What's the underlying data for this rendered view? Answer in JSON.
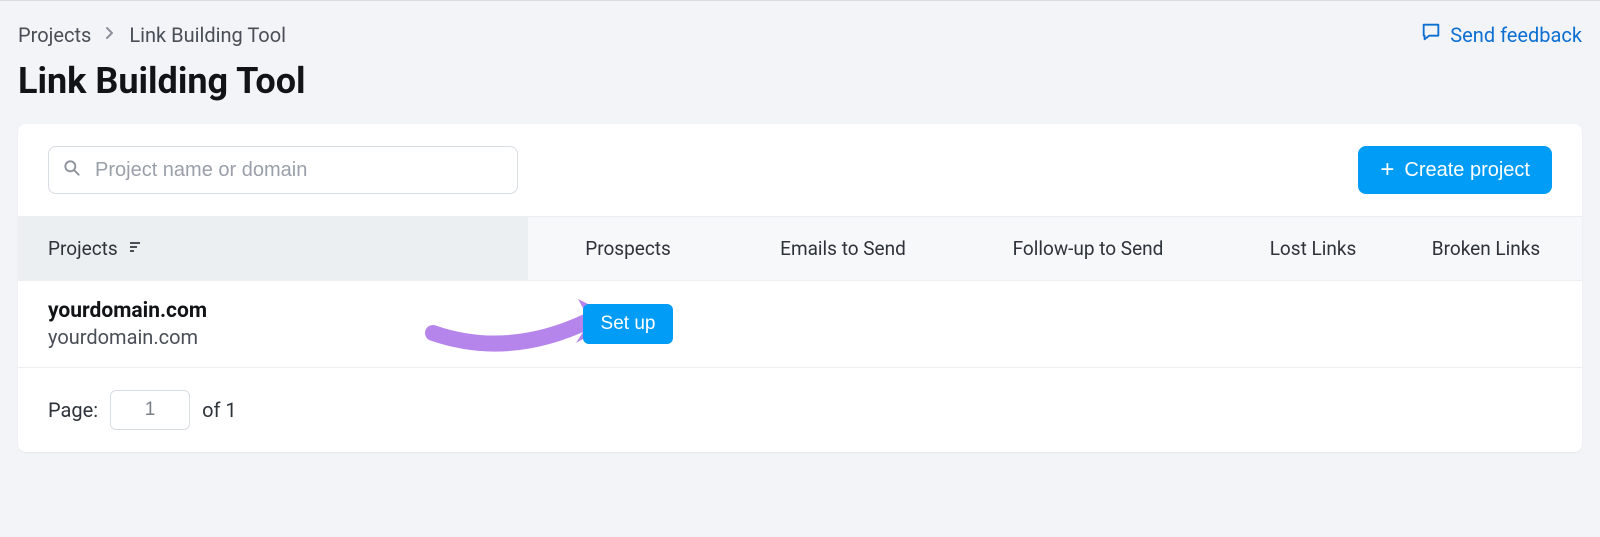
{
  "breadcrumb": {
    "root": "Projects",
    "current": "Link Building Tool"
  },
  "feedback_label": "Send feedback",
  "page_title": "Link Building Tool",
  "search": {
    "placeholder": "Project name or domain"
  },
  "create_button": "Create project",
  "columns": {
    "projects": "Projects",
    "prospects": "Prospects",
    "emails": "Emails to Send",
    "followup": "Follow-up to Send",
    "lost": "Lost Links",
    "broken": "Broken Links"
  },
  "rows": [
    {
      "name": "yourdomain.com",
      "subtitle": "yourdomain.com",
      "action_label": "Set up"
    }
  ],
  "pagination": {
    "label": "Page:",
    "current": "1",
    "of_label": "of 1"
  },
  "colors": {
    "primary": "#009cf5",
    "link": "#0c6fd1",
    "annotation": "#b685ec"
  }
}
